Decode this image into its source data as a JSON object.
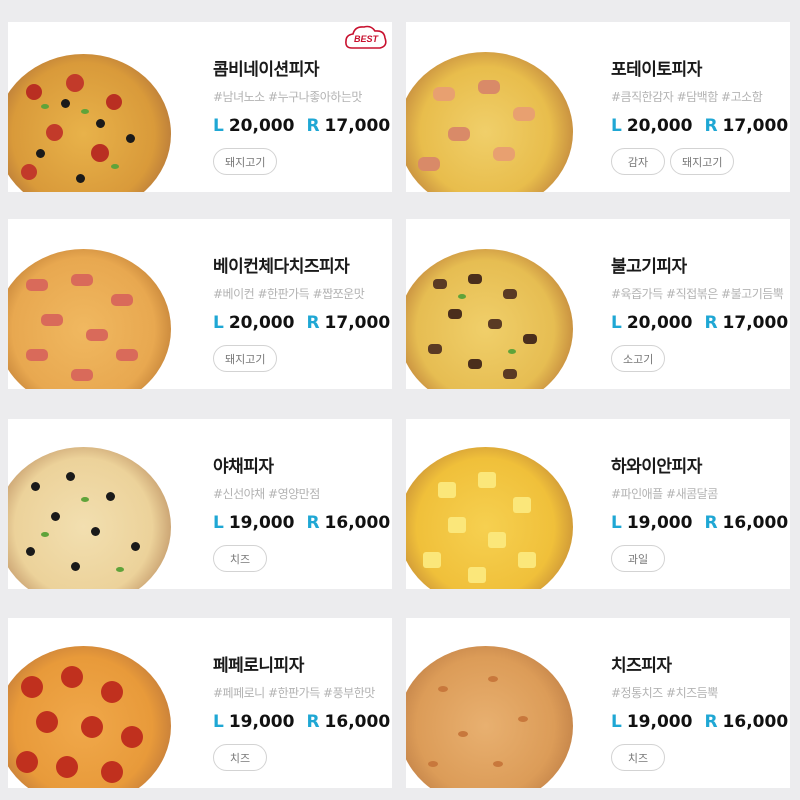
{
  "badge": {
    "best_label": "BEST"
  },
  "price_prefix": {
    "large": "L",
    "regular": "R"
  },
  "colors": {
    "background": "#ececee",
    "card": "#ffffff",
    "price_size": "#1fa7d4",
    "badge": "#c8102e"
  },
  "pizzas": [
    {
      "name": "콤비네이션피자",
      "tags": "#남녀노소 #누구나좋아하는맛",
      "price_l": "20,000",
      "price_r": "17,000",
      "chips": [
        "돼지고기"
      ],
      "best": true
    },
    {
      "name": "포테이토피자",
      "tags": "#큼직한감자 #담백함 #고소함",
      "price_l": "20,000",
      "price_r": "17,000",
      "chips": [
        "감자",
        "돼지고기"
      ]
    },
    {
      "name": "베이컨체다치즈피자",
      "tags": "#베이컨 #한판가득 #짭쪼운맛",
      "price_l": "20,000",
      "price_r": "17,000",
      "chips": [
        "돼지고기"
      ]
    },
    {
      "name": "불고기피자",
      "tags": "#육즙가득 #직접볶은 #불고기듬뿍",
      "price_l": "20,000",
      "price_r": "17,000",
      "chips": [
        "소고기"
      ]
    },
    {
      "name": "야채피자",
      "tags": "#신선야채 #영양만점",
      "price_l": "19,000",
      "price_r": "16,000",
      "chips": [
        "치즈"
      ]
    },
    {
      "name": "하와이안피자",
      "tags": "#파인애플 #새콤달콤",
      "price_l": "19,000",
      "price_r": "16,000",
      "chips": [
        "과일"
      ]
    },
    {
      "name": "페페로니피자",
      "tags": "#페페로니 #한판가득 #풍부한맛",
      "price_l": "19,000",
      "price_r": "16,000",
      "chips": [
        "치즈"
      ]
    },
    {
      "name": "치즈피자",
      "tags": "#정통치즈 #치즈듬뿍",
      "price_l": "19,000",
      "price_r": "16,000",
      "chips": [
        "치즈"
      ]
    }
  ]
}
